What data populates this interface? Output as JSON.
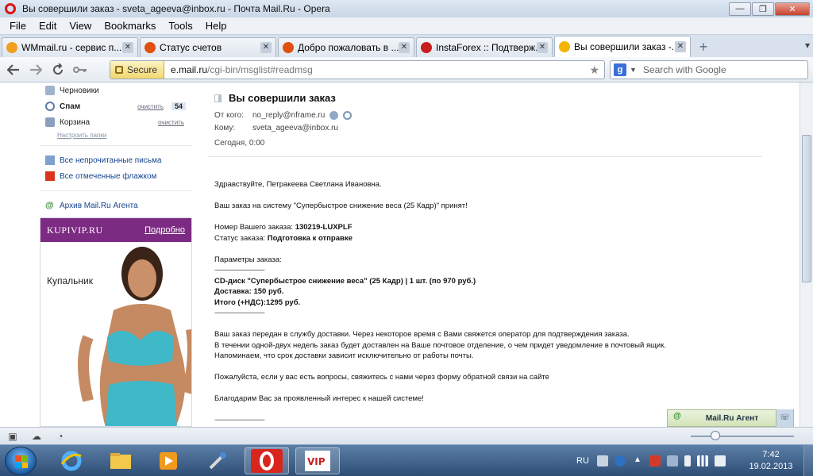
{
  "window": {
    "title": "Вы совершили заказ - sveta_ageeva@inbox.ru - Почта Mail.Ru - Opera",
    "menu": [
      "File",
      "Edit",
      "View",
      "Bookmarks",
      "Tools",
      "Help"
    ]
  },
  "tabs": [
    {
      "label": "WMmail.ru - сервис п...",
      "fav_color": "#f0a020"
    },
    {
      "label": "Статус счетов",
      "fav_color": "#e05010"
    },
    {
      "label": "Добро пожаловать в ...",
      "fav_color": "#e05010"
    },
    {
      "label": "InstaForex :: Подтверж...",
      "fav_color": "#c81e1e"
    },
    {
      "label": "Вы совершили заказ -...",
      "fav_color": "#f2b400"
    }
  ],
  "address": {
    "secure_label": "Secure",
    "url_host": "e.mail.ru",
    "url_path": "/cgi-bin/msglist#readmsg",
    "search_placeholder": "Search with Google"
  },
  "sidebar": {
    "folders": [
      {
        "label": "Черновики",
        "action": "",
        "count": ""
      },
      {
        "label": "Спам",
        "action": "очистить",
        "count": "54"
      },
      {
        "label": "Корзина",
        "action": "очистить",
        "count": ""
      }
    ],
    "folder_settings": "Настроить папки",
    "links": [
      "Все непрочитанные письма",
      "Все отмеченные флажком"
    ],
    "agent_archive": "Архив Mail.Ru Агента"
  },
  "ad": {
    "logo": "KUPIVIP.RU",
    "more": "Подробно",
    "caption": "Купальник"
  },
  "message": {
    "subject": "Вы совершили заказ",
    "from_label": "От кого:",
    "from": "no_reply@nframe.ru",
    "to_label": "Кому:",
    "to": "sveta_ageeva@inbox.ru",
    "date": "Сегодня, 0:00",
    "greeting": "Здравствуйте, Петракеева Светлана Ивановна.",
    "accepted": "Ваш заказ на систему \"Супербыстрое снижение веса (25 Кадр)\" принят!",
    "order_no_label": "Номер Вашего заказа:",
    "order_no": "130219-LUXPLF",
    "status_label": "Статус заказа:",
    "status": "Подготовка к отправке",
    "params_label": "Параметры заказа:",
    "divider": "-----------------------------",
    "item": "CD-диск \"Супербыстрое снижение веса\" (25 Кадр) | 1 шт. (по 970 руб.)",
    "delivery": "Доставка: 150 руб.",
    "total": "Итого (+НДС):1295 руб.",
    "para1": "Ваш заказ передан в службу доставки. Через некоторое время с Вами свяжется оператор для подтверждения заказа.",
    "para2": "В течении одной-двух недель заказ будет доставлен на Ваше почтовое отделение, о чем придет уведомление в почтовый ящик.",
    "para3": "Напоминаем, что срок доставки зависит исключительно от работы почты.",
    "questions": "Пожалуйста, если у вас есть вопросы, свяжитесь с нами через форму обратной связи на сайте",
    "thanks": "Благодарим Вас за проявленный интерес к нашей системе!"
  },
  "agent_widget": {
    "label": "Mail.Ru Агент"
  },
  "taskbar": {
    "lang": "RU",
    "time": "7:42",
    "date": "19.02.2013"
  }
}
